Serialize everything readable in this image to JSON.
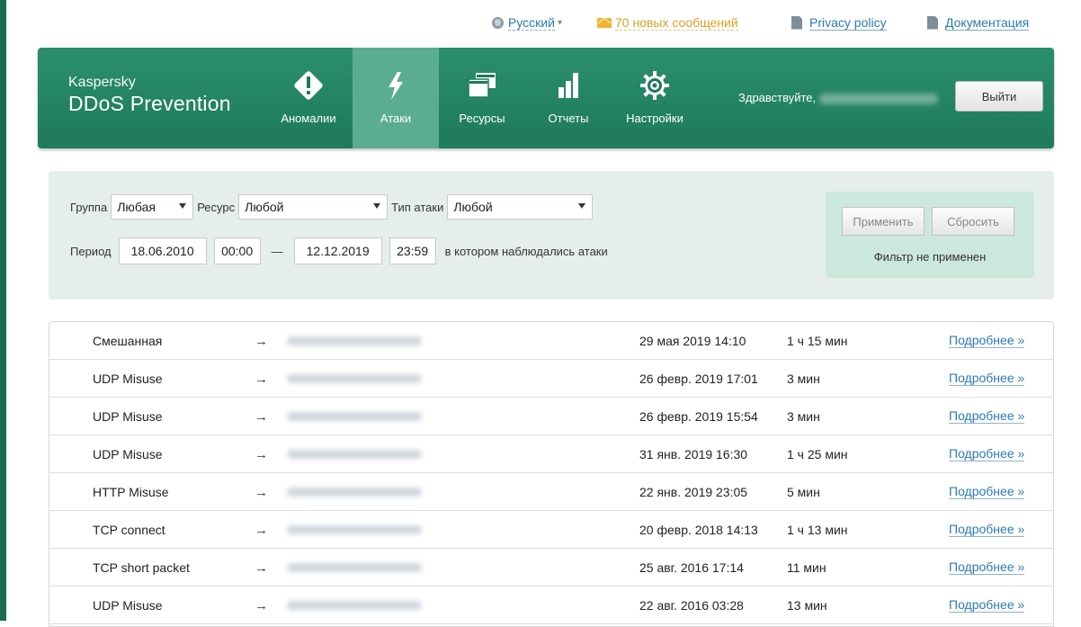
{
  "topbar": {
    "language": "Русский",
    "messages": "70 новых сообщений",
    "privacy": "Privacy policy",
    "docs": "Документация"
  },
  "header": {
    "brand_top": "Kaspersky",
    "brand_main": "DDoS Prevention",
    "nav": [
      {
        "label": "Аномалии",
        "icon": "warning-diamond-icon"
      },
      {
        "label": "Атаки",
        "icon": "lightning-icon"
      },
      {
        "label": "Ресурсы",
        "icon": "windows-icon"
      },
      {
        "label": "Отчеты",
        "icon": "bar-chart-icon"
      },
      {
        "label": "Настройки",
        "icon": "gear-icon"
      }
    ],
    "greeting": "Здравствуйте,",
    "logout": "Выйти"
  },
  "filter": {
    "group_label": "Группа",
    "group_value": "Любая",
    "resource_label": "Ресурс",
    "resource_value": "Любой",
    "attack_type_label": "Тип атаки",
    "attack_type_value": "Любой",
    "period_label": "Период",
    "date_from": "18.06.2010",
    "time_from": "00:00",
    "dash": "—",
    "date_to": "12.12.2019",
    "time_to": "23:59",
    "period_suffix": "в котором наблюдались атаки",
    "apply": "Применить",
    "reset": "Сбросить",
    "status": "Фильтр не применен"
  },
  "attacks": [
    {
      "type": "Смешанная",
      "arrow": "→",
      "date": "29 мая 2019 14:10",
      "duration": "1 ч 15 мин",
      "more": "Подробнее »"
    },
    {
      "type": "UDP Misuse",
      "arrow": "→",
      "date": "26 февр. 2019 17:01",
      "duration": "3 мин",
      "more": "Подробнее »"
    },
    {
      "type": "UDP Misuse",
      "arrow": "→",
      "date": "26 февр. 2019 15:54",
      "duration": "3 мин",
      "more": "Подробнее »"
    },
    {
      "type": "UDP Misuse",
      "arrow": "→",
      "date": "31 янв. 2019 16:30",
      "duration": "1 ч 25 мин",
      "more": "Подробнее »"
    },
    {
      "type": "HTTP Misuse",
      "arrow": "→",
      "date": "22 янв. 2019 23:05",
      "duration": "5 мин",
      "more": "Подробнее »"
    },
    {
      "type": "TCP connect",
      "arrow": "→",
      "date": "20 февр. 2018 14:13",
      "duration": "1 ч 13 мин",
      "more": "Подробнее »"
    },
    {
      "type": "TCP short packet",
      "arrow": "→",
      "date": "25 авг. 2016 17:14",
      "duration": "11 мин",
      "more": "Подробнее »"
    },
    {
      "type": "UDP Misuse",
      "arrow": "→",
      "date": "22 авг. 2016 03:28",
      "duration": "13 мин",
      "more": "Подробнее »"
    }
  ]
}
